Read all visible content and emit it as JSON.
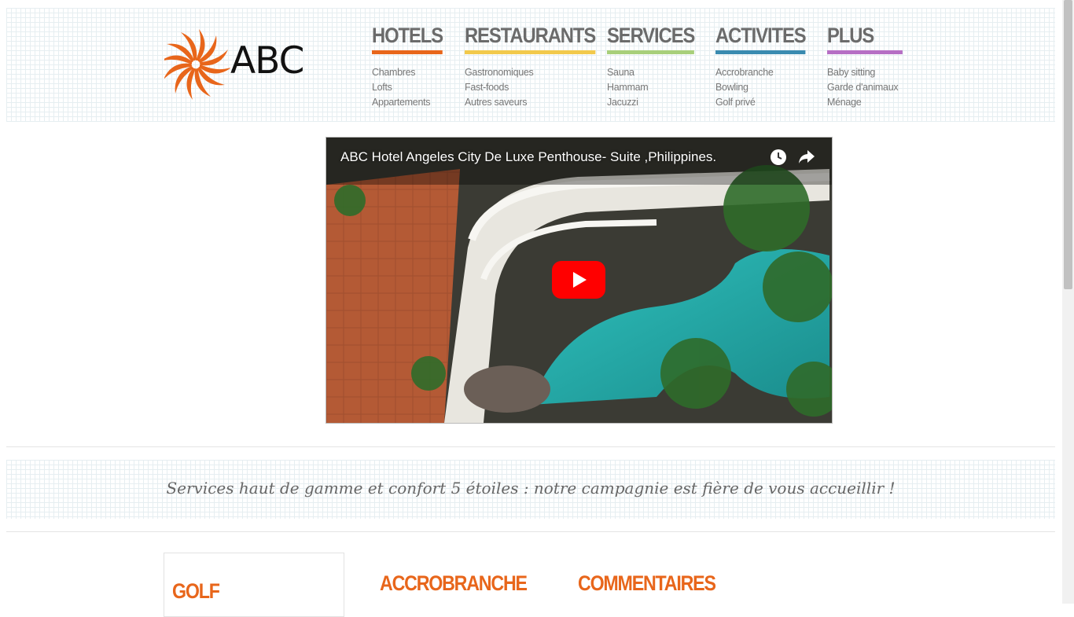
{
  "logo": {
    "text": "ABC"
  },
  "nav": [
    {
      "title": "HOTELS",
      "color": "#e8661b",
      "items": [
        "Chambres",
        "Lofts",
        "Appartements"
      ]
    },
    {
      "title": "RESTAURANTS",
      "color": "#f2c94c",
      "items": [
        "Gastronomiques",
        "Fast-foods",
        "Autres saveurs"
      ]
    },
    {
      "title": "SERVICES",
      "color": "#a8cf7a",
      "items": [
        "Sauna",
        "Hammam",
        "Jacuzzi"
      ]
    },
    {
      "title": "ACTIVITES",
      "color": "#3a8bb0",
      "items": [
        "Accrobranche",
        "Bowling",
        "Golf privé"
      ]
    },
    {
      "title": "PLUS",
      "color": "#b66fc4",
      "items": [
        "Baby sitting",
        "Garde d'animaux",
        "Ménage"
      ]
    }
  ],
  "video": {
    "title": "ABC Hotel Angeles City De Luxe Penthouse- Suite ,Philippines.",
    "icons": [
      "watch-later-icon",
      "share-icon",
      "play-icon"
    ],
    "play_color": "#ff0000"
  },
  "tagline": "Services haut de gamme et confort 5 étoiles : notre campagnie est fière de vous accueillir !",
  "sections": {
    "golf": "GOLF",
    "accrobranche": "ACCROBRANCHE",
    "commentaires": "COMMENTAIRES"
  },
  "colors": {
    "accent": "#e8661b"
  }
}
